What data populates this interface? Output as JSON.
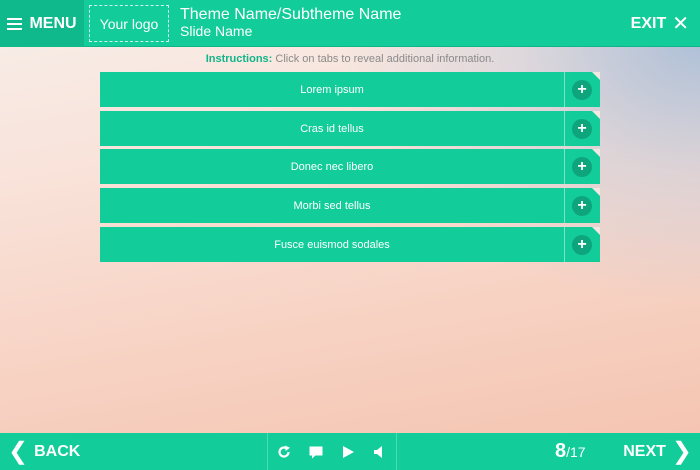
{
  "header": {
    "menu_label": "MENU",
    "logo_text": "Your logo",
    "theme_title": "Theme Name/Subtheme Name",
    "slide_name": "Slide Name",
    "exit_label": "EXIT"
  },
  "instructions": {
    "prefix": "Instructions:",
    "text": "Click on tabs to reveal additional information."
  },
  "tabs": [
    {
      "label": "Lorem ipsum",
      "icon": "plus-icon"
    },
    {
      "label": "Cras id tellus",
      "icon": "plus-icon"
    },
    {
      "label": "Donec nec libero",
      "icon": "plus-icon"
    },
    {
      "label": "Morbi sed tellus",
      "icon": "plus-icon"
    },
    {
      "label": "Fusce euismod sodales",
      "icon": "plus-icon"
    }
  ],
  "footer": {
    "back_label": "BACK",
    "next_label": "NEXT",
    "current_page": "8",
    "total_pages": "/17",
    "controls": [
      "replay-icon",
      "comment-icon",
      "play-icon",
      "volume-icon"
    ]
  },
  "colors": {
    "accent": "#12cc9a",
    "accent_dark": "#10b98c",
    "instructions_label": "#12b48a"
  }
}
